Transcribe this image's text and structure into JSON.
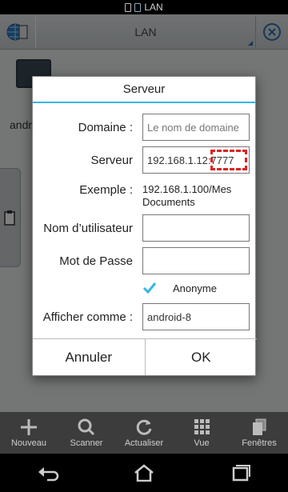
{
  "status_bar": {
    "network_label": "LAN"
  },
  "action_bar": {
    "title": "LAN"
  },
  "background": {
    "file_label": "andr"
  },
  "dialog": {
    "title": "Serveur",
    "domaine": {
      "label": "Domaine :",
      "placeholder": "Le nom de domaine"
    },
    "serveur": {
      "label": "Serveur",
      "value": "192.168.1.12:7777"
    },
    "exemple": {
      "label": "Exemple :",
      "text": "192.168.1.100/Mes Documents"
    },
    "utilisateur": {
      "label": "Nom d’utilisateur",
      "value": ""
    },
    "motdepasse": {
      "label": "Mot de Passe",
      "value": ""
    },
    "anonyme": {
      "label": "Anonyme",
      "checked": true
    },
    "afficher": {
      "label": "Afficher comme :",
      "value": "android-8"
    },
    "buttons": {
      "cancel": "Annuler",
      "ok": "OK"
    }
  },
  "toolbar": {
    "items": [
      {
        "label": "Nouveau",
        "icon": "plus-icon"
      },
      {
        "label": "Scanner",
        "icon": "search-icon"
      },
      {
        "label": "Actualiser",
        "icon": "refresh-icon"
      },
      {
        "label": "Vue",
        "icon": "grid-icon"
      },
      {
        "label": "Fenêtres",
        "icon": "windows-icon"
      }
    ]
  },
  "colors": {
    "accent": "#35b5e5",
    "highlight": "#dd2222",
    "toolbar": "#3c3c3c"
  }
}
